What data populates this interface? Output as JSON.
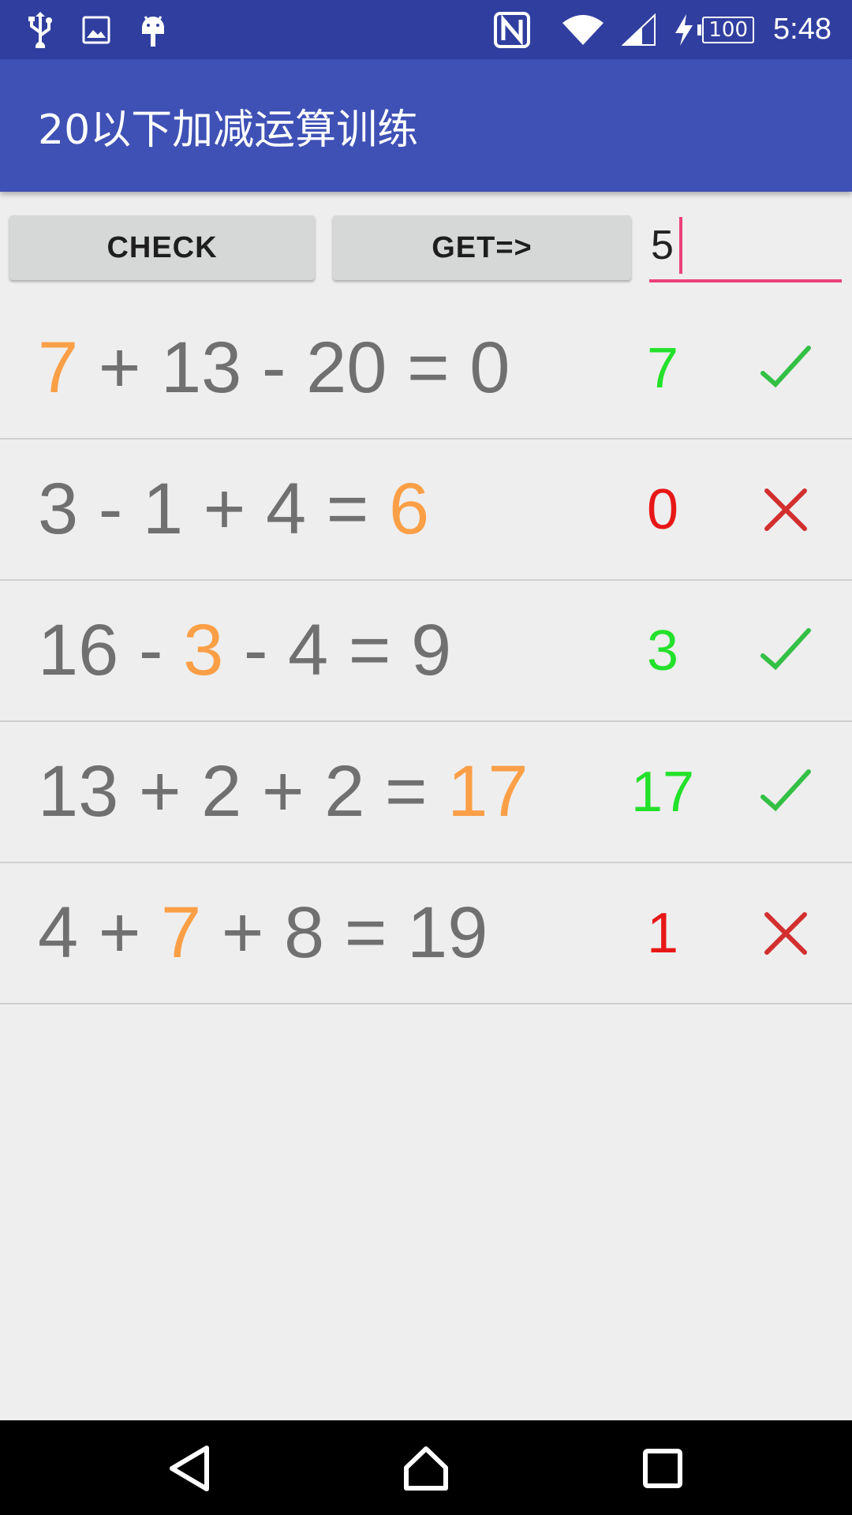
{
  "status_bar": {
    "icons_left": [
      "usb-icon",
      "image-icon",
      "android-debug-icon"
    ],
    "icons_right": [
      "nfc-icon",
      "wifi-icon",
      "cell-signal-icon",
      "charging-icon"
    ],
    "battery": "100",
    "time": "5:48"
  },
  "app_bar": {
    "title": "20以下加减运算训练"
  },
  "controls": {
    "check_label": "CHECK",
    "get_label": "GET=>",
    "input_value": "5",
    "accent_color": "#ec407a"
  },
  "colors": {
    "highlight": "#fb9f47",
    "correct": "#23e12a",
    "wrong": "#e81717",
    "text": "#707070",
    "primary": "#3f51b5",
    "primary_dark": "#303f9f"
  },
  "rows": [
    {
      "parts": [
        "",
        "7",
        " + 13 - 20 = 0"
      ],
      "answer": "7",
      "status": "correct",
      "icon": "check-icon"
    },
    {
      "parts": [
        "3 - 1 + 4 = ",
        "6",
        ""
      ],
      "answer": "0",
      "status": "wrong",
      "icon": "cross-icon"
    },
    {
      "parts": [
        "16 - ",
        "3",
        " - 4 = 9"
      ],
      "answer": "3",
      "status": "correct",
      "icon": "check-icon"
    },
    {
      "parts": [
        "13 + 2 + 2 = ",
        "17",
        ""
      ],
      "answer": "17",
      "status": "correct",
      "icon": "check-icon"
    },
    {
      "parts": [
        "4 + ",
        "7",
        " + 8 = 19"
      ],
      "answer": "1",
      "status": "wrong",
      "icon": "cross-icon"
    }
  ],
  "nav_bar": {
    "buttons": [
      "back-icon",
      "home-icon",
      "recents-icon"
    ]
  }
}
